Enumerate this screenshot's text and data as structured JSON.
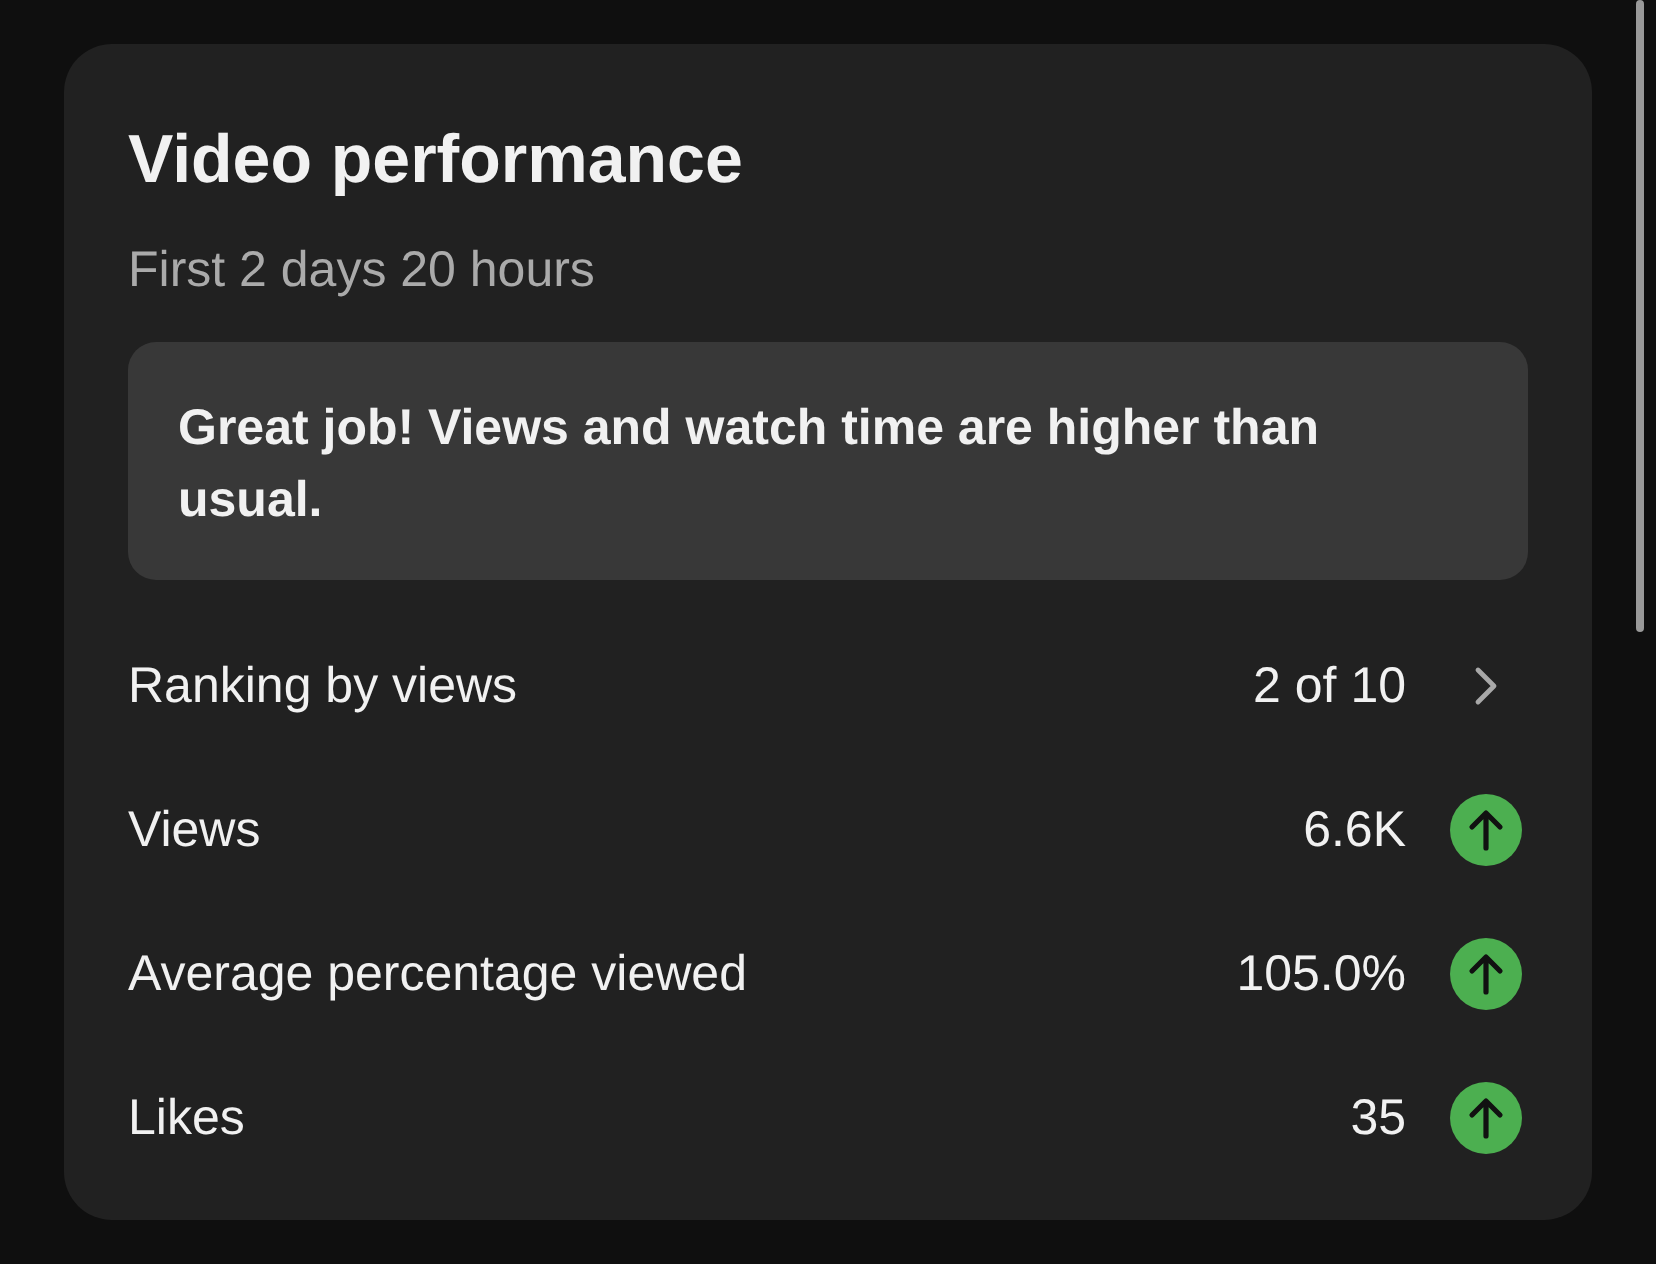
{
  "card": {
    "title": "Video performance",
    "subtitle": "First 2 days 20 hours",
    "banner": "Great job! Views and watch time are higher than usual.",
    "metrics": [
      {
        "kind": "link",
        "label": "Ranking by views",
        "value": "2 of 10"
      },
      {
        "kind": "trend",
        "rising": true,
        "label": "Views",
        "value": "6.6K"
      },
      {
        "kind": "trend",
        "rising": true,
        "label": "Average percentage viewed",
        "value": "105.0%"
      },
      {
        "kind": "trend",
        "rising": true,
        "label": "Likes",
        "value": "35"
      }
    ]
  }
}
